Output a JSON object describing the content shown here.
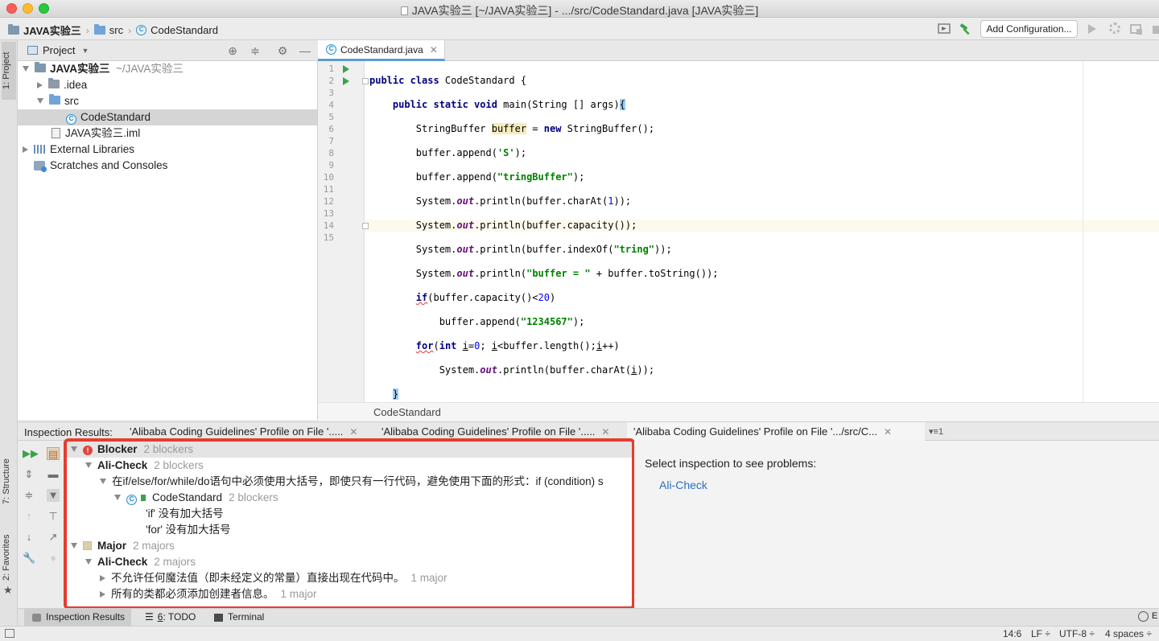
{
  "window": {
    "title": "JAVA实验三 [~/JAVA实验三] - .../src/CodeStandard.java [JAVA实验三]"
  },
  "navbar": {
    "breadcrumbs": [
      "JAVA实验三",
      "src",
      "CodeStandard"
    ],
    "add_configuration": "Add Configuration..."
  },
  "left_strip": {
    "project_tab": "1: Project",
    "structure_tab": "7: Structure",
    "favorites_tab": "2: Favorites"
  },
  "project_panel": {
    "title": "Project",
    "tree": [
      {
        "label": "JAVA实验三",
        "suffix": "~/JAVA实验三"
      },
      {
        "label": ".idea"
      },
      {
        "label": "src"
      },
      {
        "label": "CodeStandard",
        "selected": true
      },
      {
        "label": "JAVA实验三.iml"
      },
      {
        "label": "External Libraries"
      },
      {
        "label": "Scratches and Consoles"
      }
    ]
  },
  "editor": {
    "tab_label": "CodeStandard.java",
    "line_numbers": [
      "1",
      "2",
      "3",
      "4",
      "5",
      "6",
      "7",
      "8",
      "9",
      "10",
      "11",
      "12",
      "13",
      "14",
      "15"
    ],
    "footer_breadcrumb": "CodeStandard",
    "current_line": 14
  },
  "inspection": {
    "label": "Inspection Results:",
    "tabs": [
      "'Alibaba Coding Guidelines' Profile on File '.....",
      "'Alibaba Coding Guidelines' Profile on File '.....",
      "'Alibaba Coding Guidelines' Profile on File '.../src/C..."
    ],
    "tab_count": "1",
    "tree": {
      "blocker": {
        "label": "Blocker",
        "count": "2 blockers"
      },
      "blocker_check": {
        "label": "Ali-Check",
        "count": "2 blockers"
      },
      "rule1": "在if/else/for/while/do语句中必须使用大括号，即使只有一行代码，避免使用下面的形式：if (condition) s",
      "file": {
        "label": "CodeStandard",
        "count": "2 blockers"
      },
      "issue_if": "'if' 没有加大括号",
      "issue_for": "'for' 没有加大括号",
      "major": {
        "label": "Major",
        "count": "2 majors"
      },
      "major_check": {
        "label": "Ali-Check",
        "count": "2 majors"
      },
      "rule2": {
        "label": "不允许任何魔法值（即未经定义的常量）直接出现在代码中。",
        "count": "1 major"
      },
      "rule3": {
        "label": "所有的类都必须添加创建者信息。",
        "count": "1 major"
      }
    },
    "detail_title": "Select inspection to see problems:",
    "detail_link": "Ali-Check"
  },
  "bottom_tabs": {
    "inspection_results": "Inspection Results",
    "todo_prefix": "6",
    "todo_label": ": TODO",
    "terminal": "Terminal"
  },
  "status": {
    "position": "14:6",
    "line_sep": "LF ÷",
    "encoding": "UTF-8 ÷",
    "indent": "4 spaces ÷",
    "event": "E"
  },
  "colors": {
    "highlight_box": "#e53c2e",
    "keyword": "#000080",
    "string": "#008000",
    "link": "#2e6fbf"
  }
}
